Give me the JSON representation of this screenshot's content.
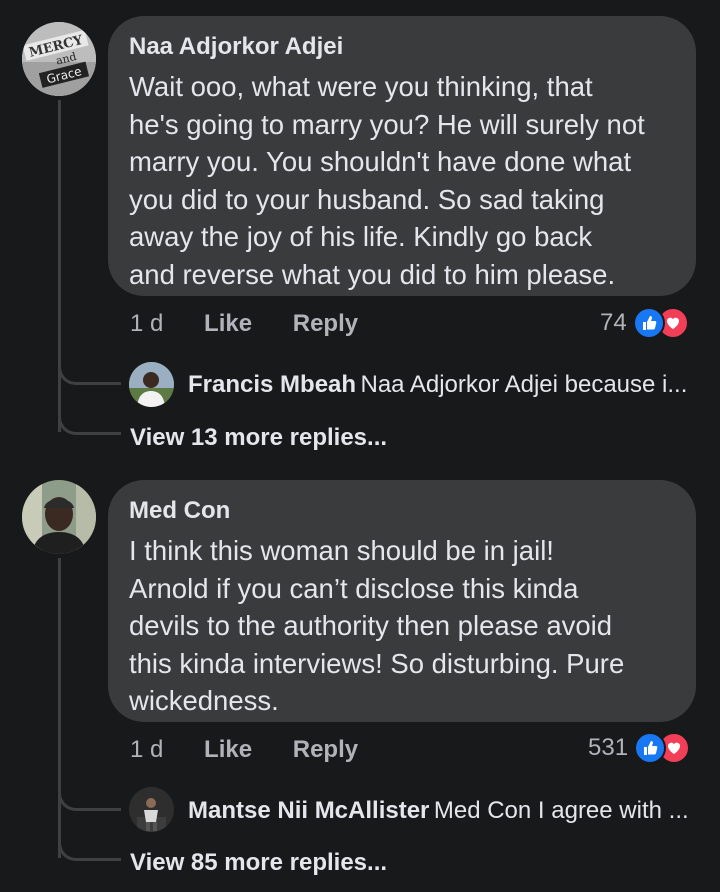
{
  "comments": [
    {
      "author": "Naa Adjorkor Adjei",
      "avatar_text": [
        "MERCY",
        "and",
        "Grace"
      ],
      "text": "Wait ooo, what were you thinking, that\nhe's going to marry you? He will surely not\nmarry you. You shouldn't have done what\nyou did to your husband. So sad taking\naway the joy of his life. Kindly go back\nand reverse what you did to him please.",
      "time": "1 d",
      "like_label": "Like",
      "reply_label": "Reply",
      "reaction_count": "74",
      "reply_preview": {
        "author": "Francis Mbeah",
        "text": "Naa Adjorkor Adjei because i..."
      },
      "more_replies": "View 13 more replies..."
    },
    {
      "author": "Med Con",
      "text": "I think this woman should be in jail!\nArnold if you can’t disclose this kinda\ndevils to the authority then please avoid\nthis kinda  interviews! So disturbing. Pure\nwickedness.",
      "time": "1 d",
      "like_label": "Like",
      "reply_label": "Reply",
      "reaction_count": "531",
      "reply_preview": {
        "author": "Mantse Nii McAllister",
        "text": "Med Con I agree with ..."
      },
      "more_replies": "View 85 more replies..."
    }
  ],
  "colors": {
    "background": "#18191a",
    "bubble": "#3a3b3c",
    "like_blue": "#1877f2",
    "love_red": "#f33e58"
  },
  "icons": [
    "like-reaction-icon",
    "love-reaction-icon"
  ]
}
